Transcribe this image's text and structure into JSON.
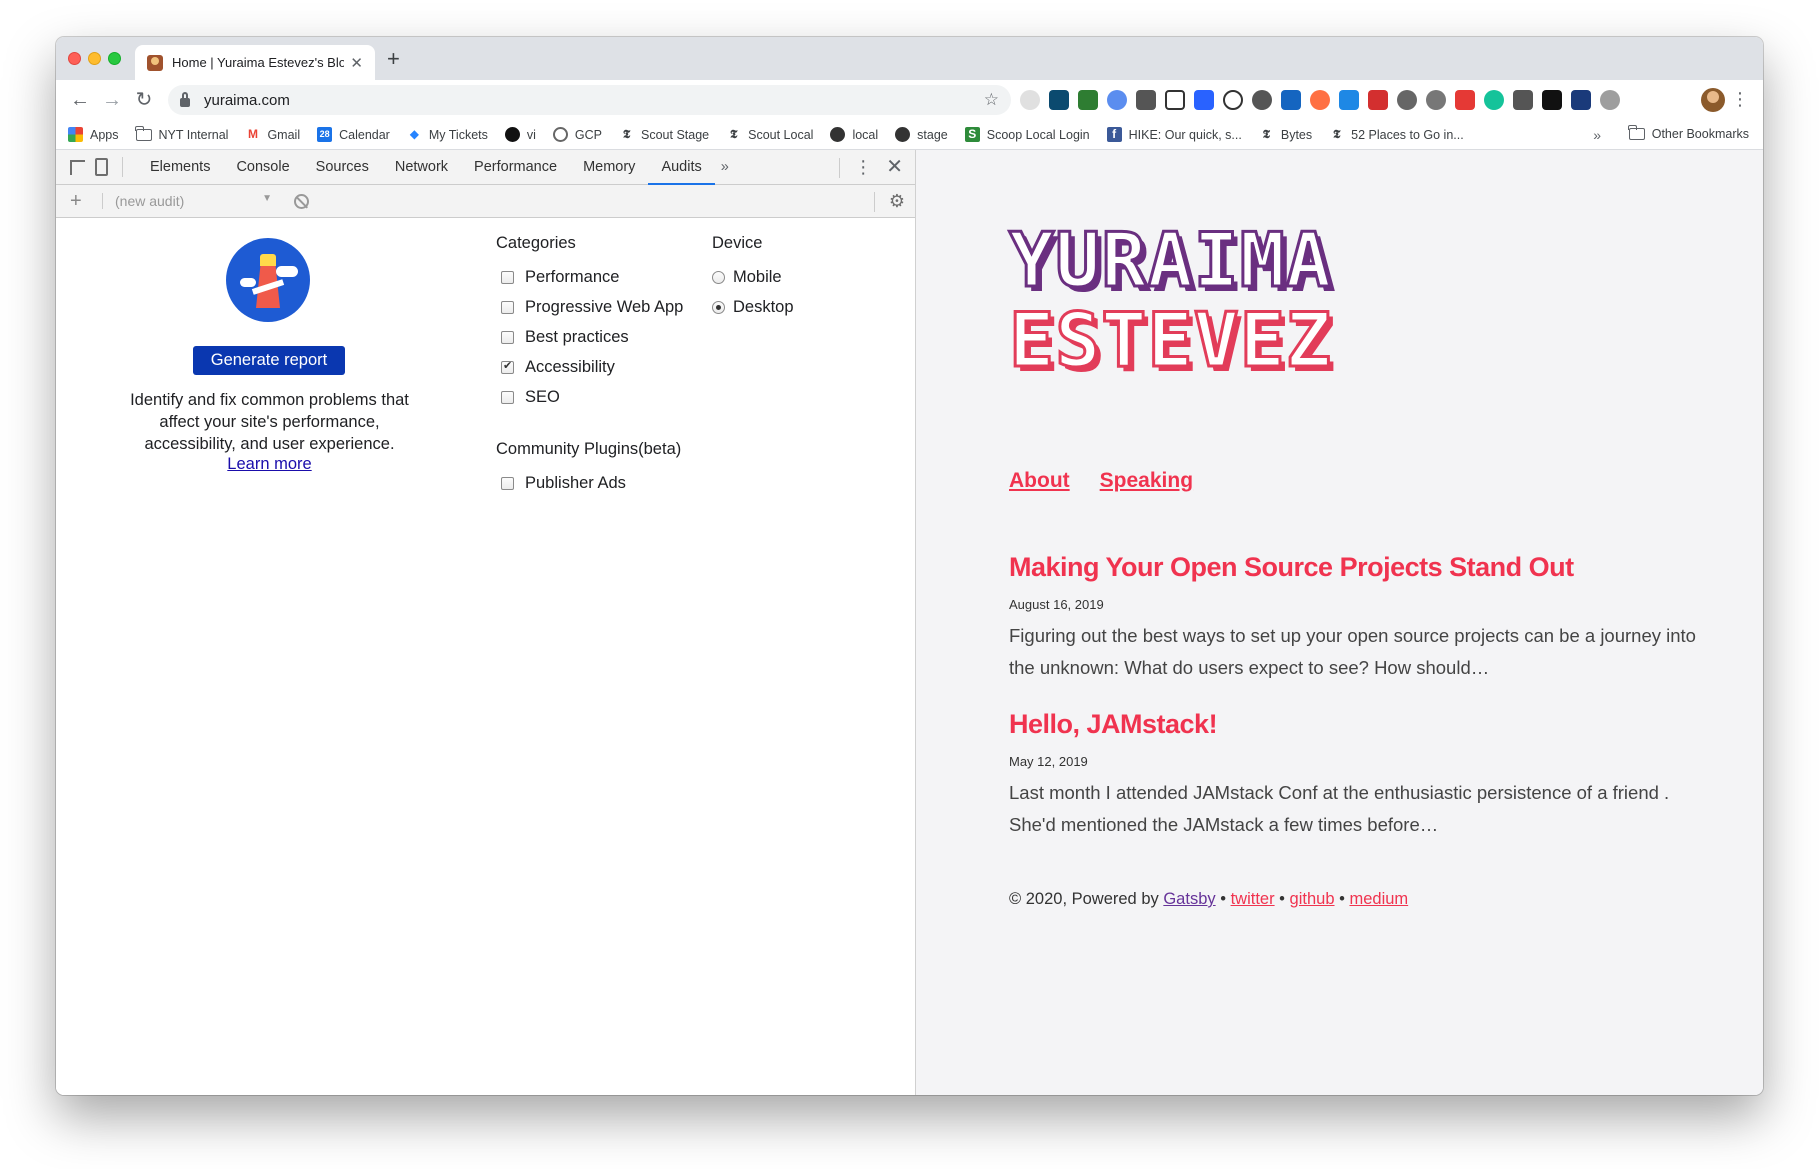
{
  "browser": {
    "tab_title": "Home | Yuraima Estevez's Blog",
    "tab_close": "✕",
    "new_tab": "+",
    "url": "yuraima.com",
    "nav": {
      "back": "←",
      "forward": "→",
      "reload": "↻"
    },
    "bookmark_star": "☆",
    "menu": "⋮"
  },
  "bookmarks": {
    "items": [
      {
        "label": "Apps",
        "icon": "apps-grid-icon"
      },
      {
        "label": "NYT Internal",
        "icon": "folder-icon"
      },
      {
        "label": "Gmail",
        "icon": "gmail-icon"
      },
      {
        "label": "Calendar",
        "icon": "calendar-icon"
      },
      {
        "label": "My Tickets",
        "icon": "jira-icon"
      },
      {
        "label": "vi",
        "icon": "github-icon"
      },
      {
        "label": "GCP",
        "icon": "gcp-icon"
      },
      {
        "label": "Scout Stage",
        "icon": "nyt-icon"
      },
      {
        "label": "Scout Local",
        "icon": "nyt-icon"
      },
      {
        "label": "local",
        "icon": "globe-icon"
      },
      {
        "label": "stage",
        "icon": "globe-icon"
      },
      {
        "label": "Scoop Local Login",
        "icon": "scoop-icon"
      },
      {
        "label": "HIKE: Our quick, s...",
        "icon": "facebook-icon"
      },
      {
        "label": "Bytes",
        "icon": "nyt-icon"
      },
      {
        "label": "52 Places to Go in...",
        "icon": "nyt-icon"
      }
    ],
    "more": "»",
    "other": "Other Bookmarks"
  },
  "devtools": {
    "tabs": [
      "Elements",
      "Console",
      "Sources",
      "Network",
      "Performance",
      "Memory",
      "Audits"
    ],
    "active_tab": "Audits",
    "overflow": "»",
    "kebab": "⋮",
    "close": "✕",
    "new_audit_plus": "+",
    "audit_select": "(new audit)",
    "audit_caret": "▼",
    "gear": "⚙",
    "audits": {
      "generate_label": "Generate report",
      "description": "Identify and fix common problems that affect your site's performance, accessibility, and user experience.",
      "learn_more": "Learn more",
      "categories_title": "Categories",
      "categories": [
        {
          "label": "Performance",
          "checked": false
        },
        {
          "label": "Progressive Web App",
          "checked": false
        },
        {
          "label": "Best practices",
          "checked": false
        },
        {
          "label": "Accessibility",
          "checked": true
        },
        {
          "label": "SEO",
          "checked": false
        }
      ],
      "device_title": "Device",
      "devices": [
        {
          "label": "Mobile",
          "selected": false
        },
        {
          "label": "Desktop",
          "selected": true
        }
      ],
      "plugins_title": "Community Plugins(beta)",
      "plugins": [
        {
          "label": "Publisher Ads",
          "checked": false
        }
      ]
    }
  },
  "site": {
    "logo_line1": "YURAIMA",
    "logo_line2": "ESTEVEZ",
    "nav": [
      "About",
      "Speaking"
    ],
    "posts": [
      {
        "title": "Making Your Open Source Projects Stand Out",
        "date": "August 16, 2019",
        "excerpt": "Figuring out the best ways to set up your open source projects can be a journey into the unknown: What do users expect to see? How should…"
      },
      {
        "title": "Hello, JAMstack!",
        "date": "May 12, 2019",
        "excerpt": "Last month I attended JAMstack Conf at the enthusiastic persistence of a friend . She'd mentioned the JAMstack a few times before…"
      }
    ],
    "footer": {
      "prefix": "© 2020, Powered by ",
      "gatsby": "Gatsby",
      "sep": " • ",
      "twitter": "twitter",
      "github": "github",
      "medium": "medium"
    }
  },
  "colors": {
    "accent": "#f0334f",
    "logo_purple": "#6a2f80",
    "lighthouse_button": "#0a37b0"
  }
}
